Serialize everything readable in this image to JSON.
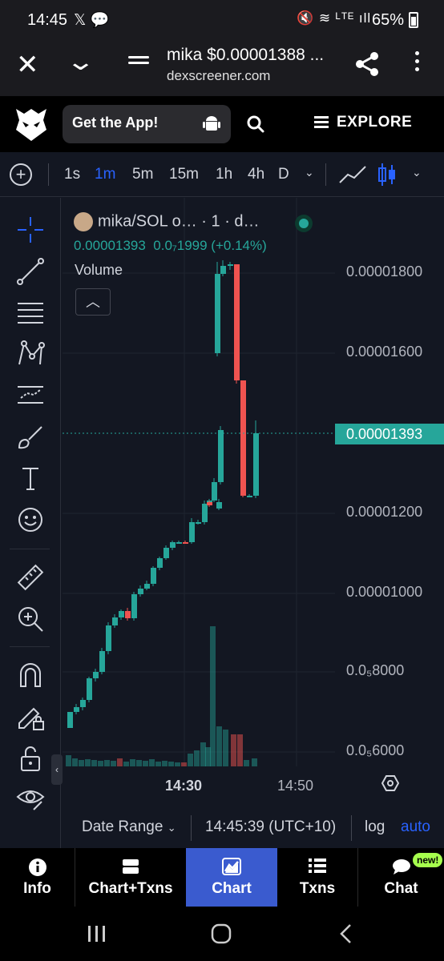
{
  "status_bar": {
    "time": "14:45",
    "battery": "65%"
  },
  "browser": {
    "page_title": "mika $0.00001388 ...",
    "domain": "dexscreener.com"
  },
  "site_header": {
    "get_app_label": "Get the App!",
    "explore_label": "EXPLORE"
  },
  "intervals": [
    {
      "label": "1s",
      "active": false
    },
    {
      "label": "1m",
      "active": true
    },
    {
      "label": "5m",
      "active": false
    },
    {
      "label": "15m",
      "active": false
    },
    {
      "label": "1h",
      "active": false
    },
    {
      "label": "4h",
      "active": false
    },
    {
      "label": "D",
      "active": false
    }
  ],
  "legend": {
    "symbol": "mika/SOL o… · 1 · d…",
    "price": "0.00001393",
    "change": "0.0₇1999 (+0.14%)",
    "volume_label": "Volume"
  },
  "tools": [
    "crosshair-icon",
    "trend-line-icon",
    "fib-retracement-icon",
    "pattern-icon",
    "prediction-icon",
    "brush-icon",
    "text-icon",
    "emoji-icon",
    "ruler-icon",
    "zoom-in-icon",
    "magnet-icon",
    "lock-drawing-icon",
    "unlock-icon",
    "eye-icon"
  ],
  "price_axis": [
    "0.00001800",
    "0.00001600",
    "0.00001200",
    "0.00001000",
    "0.0₅8000",
    "0.0₅6000"
  ],
  "last_price": "0.00001393",
  "time_axis": [
    {
      "label": "14:30",
      "bold": true
    },
    {
      "label": "14:50",
      "bold": false
    }
  ],
  "chart_footer": {
    "date_range": "Date Range",
    "clock": "14:45:39 (UTC+10)",
    "log": "log",
    "auto": "auto"
  },
  "bottom_nav": [
    {
      "label": "Info",
      "icon": "info-icon",
      "active": false
    },
    {
      "label": "Chart+Txns",
      "icon": "split-view-icon",
      "active": false
    },
    {
      "label": "Chart",
      "icon": "chart-icon",
      "active": true
    },
    {
      "label": "Txns",
      "icon": "list-icon",
      "active": false
    },
    {
      "label": "Chat",
      "icon": "chat-icon",
      "active": false
    }
  ],
  "chat_badge": "new!",
  "colors": {
    "up": "#26a69a",
    "down": "#ef5350",
    "accent": "#2962ff"
  }
}
